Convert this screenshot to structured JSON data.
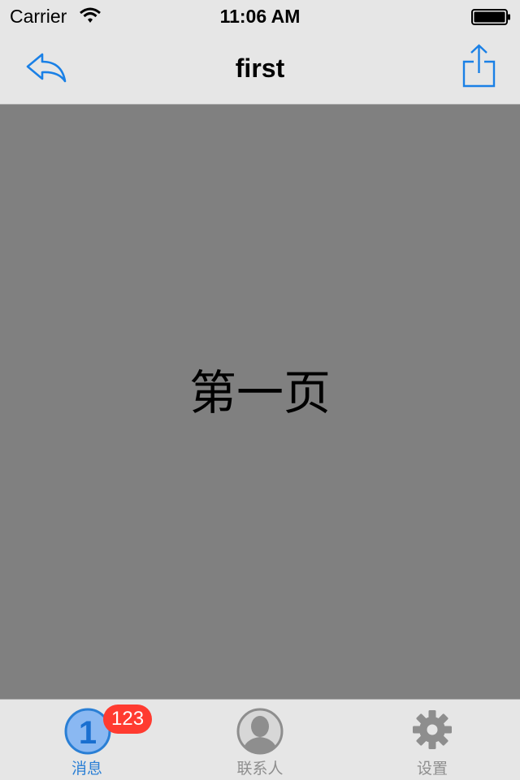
{
  "status_bar": {
    "carrier": "Carrier",
    "time": "11:06 AM",
    "wifi_icon": "wifi-icon",
    "battery_icon": "battery-full-icon"
  },
  "nav_bar": {
    "title": "first",
    "back_icon": "reply-arrow-icon",
    "share_icon": "share-icon",
    "tint_color": "#1a80e6"
  },
  "content": {
    "label": "第一页",
    "background_color": "#808080"
  },
  "tab_bar": {
    "selected_color": "#2a7fd5",
    "unselected_color": "#8e8e8e",
    "tabs": [
      {
        "label": "消息",
        "icon": "number-one-icon",
        "icon_text": "1",
        "badge": "123",
        "selected": true
      },
      {
        "label": "联系人",
        "icon": "contact-avatar-icon",
        "selected": false
      },
      {
        "label": "设置",
        "icon": "gear-icon",
        "selected": false
      }
    ]
  }
}
